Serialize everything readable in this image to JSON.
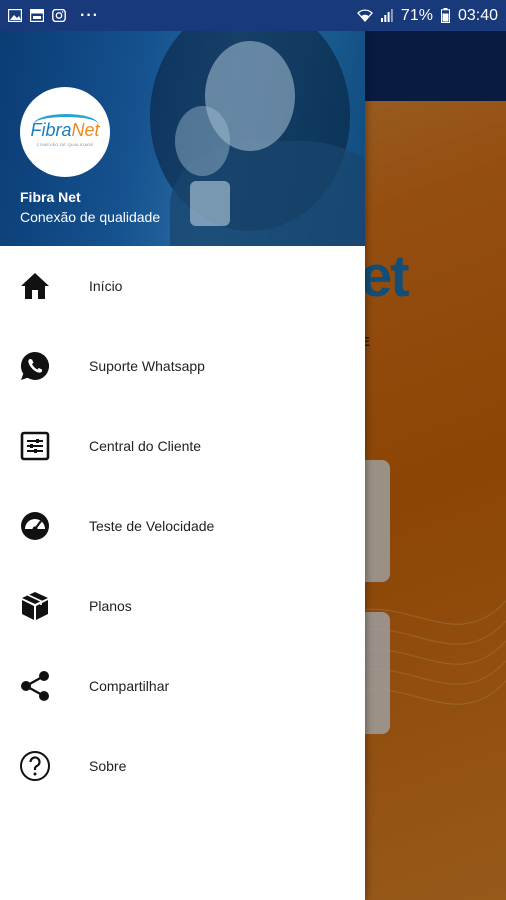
{
  "status_bar": {
    "battery": "71%",
    "time": "03:40",
    "more": "···"
  },
  "background": {
    "logo_text": "et",
    "logo_sub": "DE"
  },
  "drawer": {
    "logo": {
      "word_a": "Fibra",
      "word_b": "Net",
      "tagline": "CONEXÃO DE QUALIDADE"
    },
    "title": "Fibra Net",
    "subtitle": "Conexão de qualidade",
    "items": [
      {
        "label": "Início",
        "icon": "home-icon"
      },
      {
        "label": "Suporte Whatsapp",
        "icon": "whatsapp-icon"
      },
      {
        "label": "Central do Cliente",
        "icon": "settings-panel-icon"
      },
      {
        "label": "Teste de Velocidade",
        "icon": "speedometer-icon"
      },
      {
        "label": "Planos",
        "icon": "box-icon"
      },
      {
        "label": "Compartilhar",
        "icon": "share-icon"
      },
      {
        "label": "Sobre",
        "icon": "help-icon"
      }
    ]
  },
  "colors": {
    "status_bar": "#18397a",
    "accent_blue": "#1c7dc1",
    "accent_orange": "#f08a1c",
    "background_orange": "#e07a10"
  }
}
